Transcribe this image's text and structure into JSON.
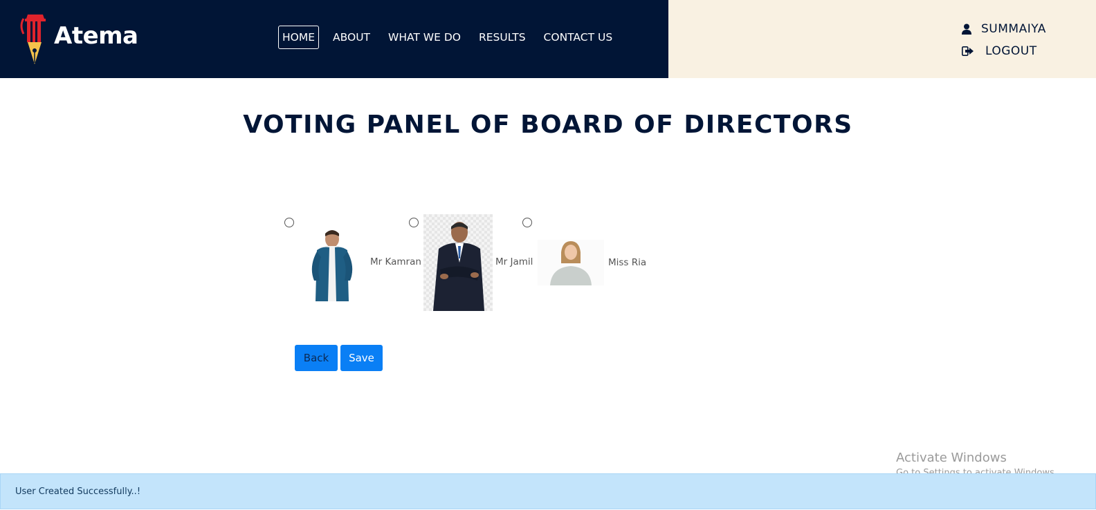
{
  "brand": {
    "name": "Atema",
    "icon": "pen-nib-pillar-logo"
  },
  "nav": {
    "items": [
      {
        "label": "HOME",
        "active": true
      },
      {
        "label": "ABOUT",
        "active": false
      },
      {
        "label": "WHAT WE DO",
        "active": false
      },
      {
        "label": "RESULTS",
        "active": false
      },
      {
        "label": "CONTACT US",
        "active": false
      }
    ]
  },
  "user": {
    "name": "SUMMAIYA",
    "user_icon": "user-icon",
    "logout_label": "LOGOUT",
    "logout_icon": "sign-out-icon"
  },
  "page": {
    "title": "VOTING PANEL OF BOARD OF DIRECTORS"
  },
  "candidates": [
    {
      "name": "Mr Kamran",
      "selected": false,
      "photo": "man-blue-jacket-photo"
    },
    {
      "name": "Mr Jamil",
      "selected": false,
      "photo": "man-dark-suit-photo"
    },
    {
      "name": "Miss Ria",
      "selected": false,
      "photo": "woman-grey-sweater-photo"
    }
  ],
  "actions": {
    "back_label": "Back",
    "save_label": "Save"
  },
  "watermark": {
    "title": "Activate Windows",
    "subtitle": "Go to Settings to activate Windows."
  },
  "alert": {
    "message": "User Created Successfully..!"
  },
  "colors": {
    "navy": "#011536",
    "cream": "#f9f1e2",
    "primary": "#0a7ff5",
    "alert_bg": "#c3e4fb"
  }
}
